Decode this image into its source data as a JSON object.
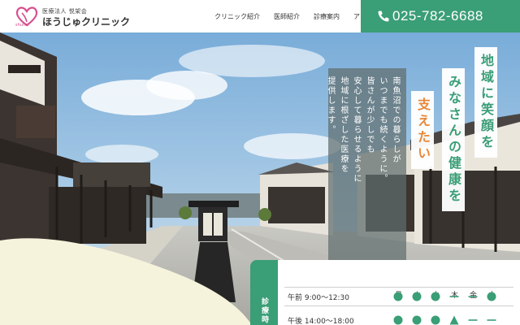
{
  "header": {
    "logo": {
      "sub": "医療法人 悦架会",
      "name": "ほうじゅクリニック",
      "tiny": "shuhei"
    },
    "nav": [
      {
        "label": "クリニック紹介"
      },
      {
        "label": "医師紹介"
      },
      {
        "label": "診療案内"
      },
      {
        "label": "ア"
      }
    ],
    "phone": {
      "number": "025-782-6688",
      "icon": "phone-icon"
    }
  },
  "hero": {
    "catch": {
      "line1": "地域に笑顔を",
      "line2": "みなさんの健康を",
      "line3": "支えたい"
    },
    "message": {
      "col1": "南魚沼での暮らしが",
      "col2": "いつまでも続くように。",
      "col3": "皆さんが少しでも",
      "col4": "安心して暮らせるように",
      "col5": "地域に根ざした医療を",
      "col6": "提供します。"
    }
  },
  "hours": {
    "tab_label": "診療時",
    "days": [
      "月",
      "火",
      "水",
      "木",
      "金",
      "土"
    ],
    "rows": [
      {
        "label": "午前 9:00～12:30",
        "marks": [
          "circle",
          "circle",
          "circle",
          "dash",
          "dash",
          "circle"
        ]
      },
      {
        "label": "午後 14:00～18:00",
        "marks": [
          "circle",
          "circle",
          "circle",
          "triangle",
          "dash",
          "dash"
        ]
      }
    ]
  },
  "colors": {
    "brand_green": "#3a9e77",
    "accent_orange": "#e8883a",
    "logo_pink": "#d64f8e",
    "cream": "#f6f3dc"
  }
}
